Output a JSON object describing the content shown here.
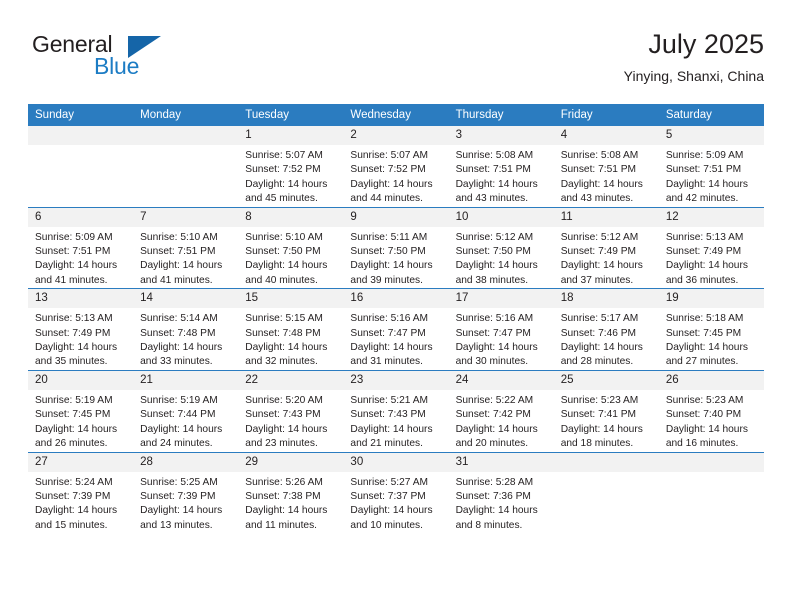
{
  "brand": {
    "name_part1": "General",
    "name_part2": "Blue",
    "logo_icon": "triangle-logo-icon"
  },
  "header": {
    "title": "July 2025",
    "subtitle": "Yinying, Shanxi, China"
  },
  "calendar": {
    "weekday_headers": [
      "Sunday",
      "Monday",
      "Tuesday",
      "Wednesday",
      "Thursday",
      "Friday",
      "Saturday"
    ],
    "header_bg": "#2b7cc0",
    "daynum_bg": "#f2f2f2",
    "weeks": [
      [
        {
          "day": "",
          "blank": true,
          "sunrise": "",
          "sunset": "",
          "daylight_line1": "",
          "daylight_line2": ""
        },
        {
          "day": "",
          "blank": true,
          "sunrise": "",
          "sunset": "",
          "daylight_line1": "",
          "daylight_line2": ""
        },
        {
          "day": "1",
          "blank": false,
          "sunrise": "Sunrise: 5:07 AM",
          "sunset": "Sunset: 7:52 PM",
          "daylight_line1": "Daylight: 14 hours",
          "daylight_line2": "and 45 minutes."
        },
        {
          "day": "2",
          "blank": false,
          "sunrise": "Sunrise: 5:07 AM",
          "sunset": "Sunset: 7:52 PM",
          "daylight_line1": "Daylight: 14 hours",
          "daylight_line2": "and 44 minutes."
        },
        {
          "day": "3",
          "blank": false,
          "sunrise": "Sunrise: 5:08 AM",
          "sunset": "Sunset: 7:51 PM",
          "daylight_line1": "Daylight: 14 hours",
          "daylight_line2": "and 43 minutes."
        },
        {
          "day": "4",
          "blank": false,
          "sunrise": "Sunrise: 5:08 AM",
          "sunset": "Sunset: 7:51 PM",
          "daylight_line1": "Daylight: 14 hours",
          "daylight_line2": "and 43 minutes."
        },
        {
          "day": "5",
          "blank": false,
          "sunrise": "Sunrise: 5:09 AM",
          "sunset": "Sunset: 7:51 PM",
          "daylight_line1": "Daylight: 14 hours",
          "daylight_line2": "and 42 minutes."
        }
      ],
      [
        {
          "day": "6",
          "blank": false,
          "sunrise": "Sunrise: 5:09 AM",
          "sunset": "Sunset: 7:51 PM",
          "daylight_line1": "Daylight: 14 hours",
          "daylight_line2": "and 41 minutes."
        },
        {
          "day": "7",
          "blank": false,
          "sunrise": "Sunrise: 5:10 AM",
          "sunset": "Sunset: 7:51 PM",
          "daylight_line1": "Daylight: 14 hours",
          "daylight_line2": "and 41 minutes."
        },
        {
          "day": "8",
          "blank": false,
          "sunrise": "Sunrise: 5:10 AM",
          "sunset": "Sunset: 7:50 PM",
          "daylight_line1": "Daylight: 14 hours",
          "daylight_line2": "and 40 minutes."
        },
        {
          "day": "9",
          "blank": false,
          "sunrise": "Sunrise: 5:11 AM",
          "sunset": "Sunset: 7:50 PM",
          "daylight_line1": "Daylight: 14 hours",
          "daylight_line2": "and 39 minutes."
        },
        {
          "day": "10",
          "blank": false,
          "sunrise": "Sunrise: 5:12 AM",
          "sunset": "Sunset: 7:50 PM",
          "daylight_line1": "Daylight: 14 hours",
          "daylight_line2": "and 38 minutes."
        },
        {
          "day": "11",
          "blank": false,
          "sunrise": "Sunrise: 5:12 AM",
          "sunset": "Sunset: 7:49 PM",
          "daylight_line1": "Daylight: 14 hours",
          "daylight_line2": "and 37 minutes."
        },
        {
          "day": "12",
          "blank": false,
          "sunrise": "Sunrise: 5:13 AM",
          "sunset": "Sunset: 7:49 PM",
          "daylight_line1": "Daylight: 14 hours",
          "daylight_line2": "and 36 minutes."
        }
      ],
      [
        {
          "day": "13",
          "blank": false,
          "sunrise": "Sunrise: 5:13 AM",
          "sunset": "Sunset: 7:49 PM",
          "daylight_line1": "Daylight: 14 hours",
          "daylight_line2": "and 35 minutes."
        },
        {
          "day": "14",
          "blank": false,
          "sunrise": "Sunrise: 5:14 AM",
          "sunset": "Sunset: 7:48 PM",
          "daylight_line1": "Daylight: 14 hours",
          "daylight_line2": "and 33 minutes."
        },
        {
          "day": "15",
          "blank": false,
          "sunrise": "Sunrise: 5:15 AM",
          "sunset": "Sunset: 7:48 PM",
          "daylight_line1": "Daylight: 14 hours",
          "daylight_line2": "and 32 minutes."
        },
        {
          "day": "16",
          "blank": false,
          "sunrise": "Sunrise: 5:16 AM",
          "sunset": "Sunset: 7:47 PM",
          "daylight_line1": "Daylight: 14 hours",
          "daylight_line2": "and 31 minutes."
        },
        {
          "day": "17",
          "blank": false,
          "sunrise": "Sunrise: 5:16 AM",
          "sunset": "Sunset: 7:47 PM",
          "daylight_line1": "Daylight: 14 hours",
          "daylight_line2": "and 30 minutes."
        },
        {
          "day": "18",
          "blank": false,
          "sunrise": "Sunrise: 5:17 AM",
          "sunset": "Sunset: 7:46 PM",
          "daylight_line1": "Daylight: 14 hours",
          "daylight_line2": "and 28 minutes."
        },
        {
          "day": "19",
          "blank": false,
          "sunrise": "Sunrise: 5:18 AM",
          "sunset": "Sunset: 7:45 PM",
          "daylight_line1": "Daylight: 14 hours",
          "daylight_line2": "and 27 minutes."
        }
      ],
      [
        {
          "day": "20",
          "blank": false,
          "sunrise": "Sunrise: 5:19 AM",
          "sunset": "Sunset: 7:45 PM",
          "daylight_line1": "Daylight: 14 hours",
          "daylight_line2": "and 26 minutes."
        },
        {
          "day": "21",
          "blank": false,
          "sunrise": "Sunrise: 5:19 AM",
          "sunset": "Sunset: 7:44 PM",
          "daylight_line1": "Daylight: 14 hours",
          "daylight_line2": "and 24 minutes."
        },
        {
          "day": "22",
          "blank": false,
          "sunrise": "Sunrise: 5:20 AM",
          "sunset": "Sunset: 7:43 PM",
          "daylight_line1": "Daylight: 14 hours",
          "daylight_line2": "and 23 minutes."
        },
        {
          "day": "23",
          "blank": false,
          "sunrise": "Sunrise: 5:21 AM",
          "sunset": "Sunset: 7:43 PM",
          "daylight_line1": "Daylight: 14 hours",
          "daylight_line2": "and 21 minutes."
        },
        {
          "day": "24",
          "blank": false,
          "sunrise": "Sunrise: 5:22 AM",
          "sunset": "Sunset: 7:42 PM",
          "daylight_line1": "Daylight: 14 hours",
          "daylight_line2": "and 20 minutes."
        },
        {
          "day": "25",
          "blank": false,
          "sunrise": "Sunrise: 5:23 AM",
          "sunset": "Sunset: 7:41 PM",
          "daylight_line1": "Daylight: 14 hours",
          "daylight_line2": "and 18 minutes."
        },
        {
          "day": "26",
          "blank": false,
          "sunrise": "Sunrise: 5:23 AM",
          "sunset": "Sunset: 7:40 PM",
          "daylight_line1": "Daylight: 14 hours",
          "daylight_line2": "and 16 minutes."
        }
      ],
      [
        {
          "day": "27",
          "blank": false,
          "sunrise": "Sunrise: 5:24 AM",
          "sunset": "Sunset: 7:39 PM",
          "daylight_line1": "Daylight: 14 hours",
          "daylight_line2": "and 15 minutes."
        },
        {
          "day": "28",
          "blank": false,
          "sunrise": "Sunrise: 5:25 AM",
          "sunset": "Sunset: 7:39 PM",
          "daylight_line1": "Daylight: 14 hours",
          "daylight_line2": "and 13 minutes."
        },
        {
          "day": "29",
          "blank": false,
          "sunrise": "Sunrise: 5:26 AM",
          "sunset": "Sunset: 7:38 PM",
          "daylight_line1": "Daylight: 14 hours",
          "daylight_line2": "and 11 minutes."
        },
        {
          "day": "30",
          "blank": false,
          "sunrise": "Sunrise: 5:27 AM",
          "sunset": "Sunset: 7:37 PM",
          "daylight_line1": "Daylight: 14 hours",
          "daylight_line2": "and 10 minutes."
        },
        {
          "day": "31",
          "blank": false,
          "sunrise": "Sunrise: 5:28 AM",
          "sunset": "Sunset: 7:36 PM",
          "daylight_line1": "Daylight: 14 hours",
          "daylight_line2": "and 8 minutes."
        },
        {
          "day": "",
          "blank": true,
          "sunrise": "",
          "sunset": "",
          "daylight_line1": "",
          "daylight_line2": ""
        },
        {
          "day": "",
          "blank": true,
          "sunrise": "",
          "sunset": "",
          "daylight_line1": "",
          "daylight_line2": ""
        }
      ]
    ]
  }
}
